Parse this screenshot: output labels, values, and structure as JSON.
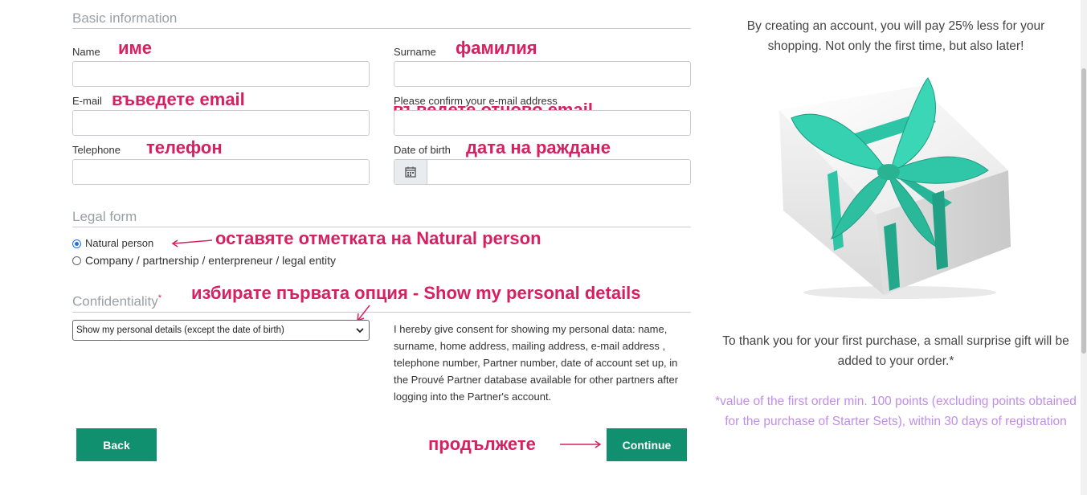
{
  "basic_info": {
    "title": "Basic information",
    "name_label": "Name",
    "surname_label": "Surname",
    "email_label": "E-mail",
    "confirm_email_label": "Please confirm your e-mail address",
    "telephone_label": "Telephone",
    "dob_label": "Date of birth"
  },
  "legal_form": {
    "title": "Legal form",
    "option_natural": "Natural person",
    "option_company": "Company / partnership / enterpreneur / legal entity",
    "selected": "Natural person"
  },
  "confidentiality": {
    "title": "Confidentiality",
    "required_mark": "*",
    "select_value": "Show my personal details (except the date of birth)",
    "consent_text": "I hereby give consent for showing my personal data: name, surname, home address, mailing address, e-mail address , telephone number, Partner number, date of account set up, in the Prouvé Partner database available for other partners after logging into the Partner's account."
  },
  "buttons": {
    "back": "Back",
    "continue": "Continue"
  },
  "annotations": {
    "name": "име",
    "surname": "фамилия",
    "email": "въведете email",
    "confirm_email": "въведете отново email",
    "telephone": "телефон",
    "dob": "дата на раждане",
    "natural_person": "оставяте отметката на Natural person",
    "confidentiality": "избирате първата опция - Show my personal details",
    "continue": "продължете"
  },
  "promo": {
    "top_text": "By creating an account, you will pay 25% less for your shopping. Not only the first time, but also later!",
    "gift_text": "To thank you for your first purchase, a small surprise gift will be added to your order.*",
    "footnote": "*value of the first order min. 100 points (excluding points obtained for the purchase of Starter Sets), within 30 days of registration"
  },
  "colors": {
    "accent": "#10906f",
    "annotation": "#d6205f",
    "footnote": "#c08ee8",
    "ribbon": "#2ec4a6"
  }
}
